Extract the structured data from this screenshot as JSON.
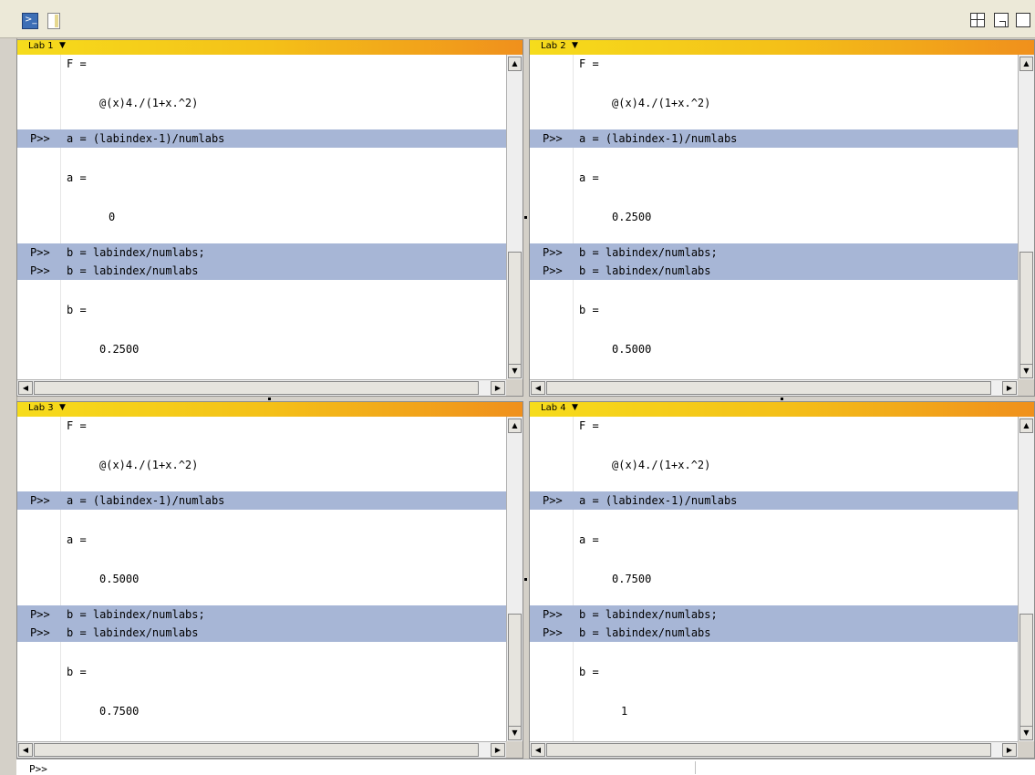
{
  "toolbar": {
    "command_window_icon": "command-window-icon",
    "document_icon": "document-icon"
  },
  "tiling": {
    "grid_icon": "grid-layout-icon",
    "dock_icon": "dock-icon",
    "single_icon": "single-window-icon"
  },
  "labs": [
    {
      "title": "Lab 1",
      "F_label": "F =",
      "F_value": "@(x)4./(1+x.^2)",
      "prompt": "P>>",
      "cmd_a": "a = (labindex-1)/numlabs",
      "a_label": "a =",
      "a_value": "0",
      "cmd_b1": "b = labindex/numlabs;",
      "cmd_b2": "b = labindex/numlabs",
      "b_label": "b =",
      "b_value": "0.2500"
    },
    {
      "title": "Lab 2",
      "F_label": "F =",
      "F_value": "@(x)4./(1+x.^2)",
      "prompt": "P>>",
      "cmd_a": "a = (labindex-1)/numlabs",
      "a_label": "a =",
      "a_value": "0.2500",
      "cmd_b1": "b = labindex/numlabs;",
      "cmd_b2": "b = labindex/numlabs",
      "b_label": "b =",
      "b_value": "0.5000"
    },
    {
      "title": "Lab 3",
      "F_label": "F =",
      "F_value": "@(x)4./(1+x.^2)",
      "prompt": "P>>",
      "cmd_a": "a = (labindex-1)/numlabs",
      "a_label": "a =",
      "a_value": "0.5000",
      "cmd_b1": "b = labindex/numlabs;",
      "cmd_b2": "b = labindex/numlabs",
      "b_label": "b =",
      "b_value": "0.7500"
    },
    {
      "title": "Lab 4",
      "F_label": "F =",
      "F_value": "@(x)4./(1+x.^2)",
      "prompt": "P>>",
      "cmd_a": "a = (labindex-1)/numlabs",
      "a_label": "a =",
      "a_value": "0.7500",
      "cmd_b1": "b = labindex/numlabs;",
      "cmd_b2": "b = labindex/numlabs",
      "b_label": "b =",
      "b_value": "1"
    }
  ],
  "caret": "▼",
  "scroll": {
    "up": "▲",
    "down": "▼",
    "left": "◀",
    "right": "▶"
  },
  "bottom_prompt": "P>>"
}
